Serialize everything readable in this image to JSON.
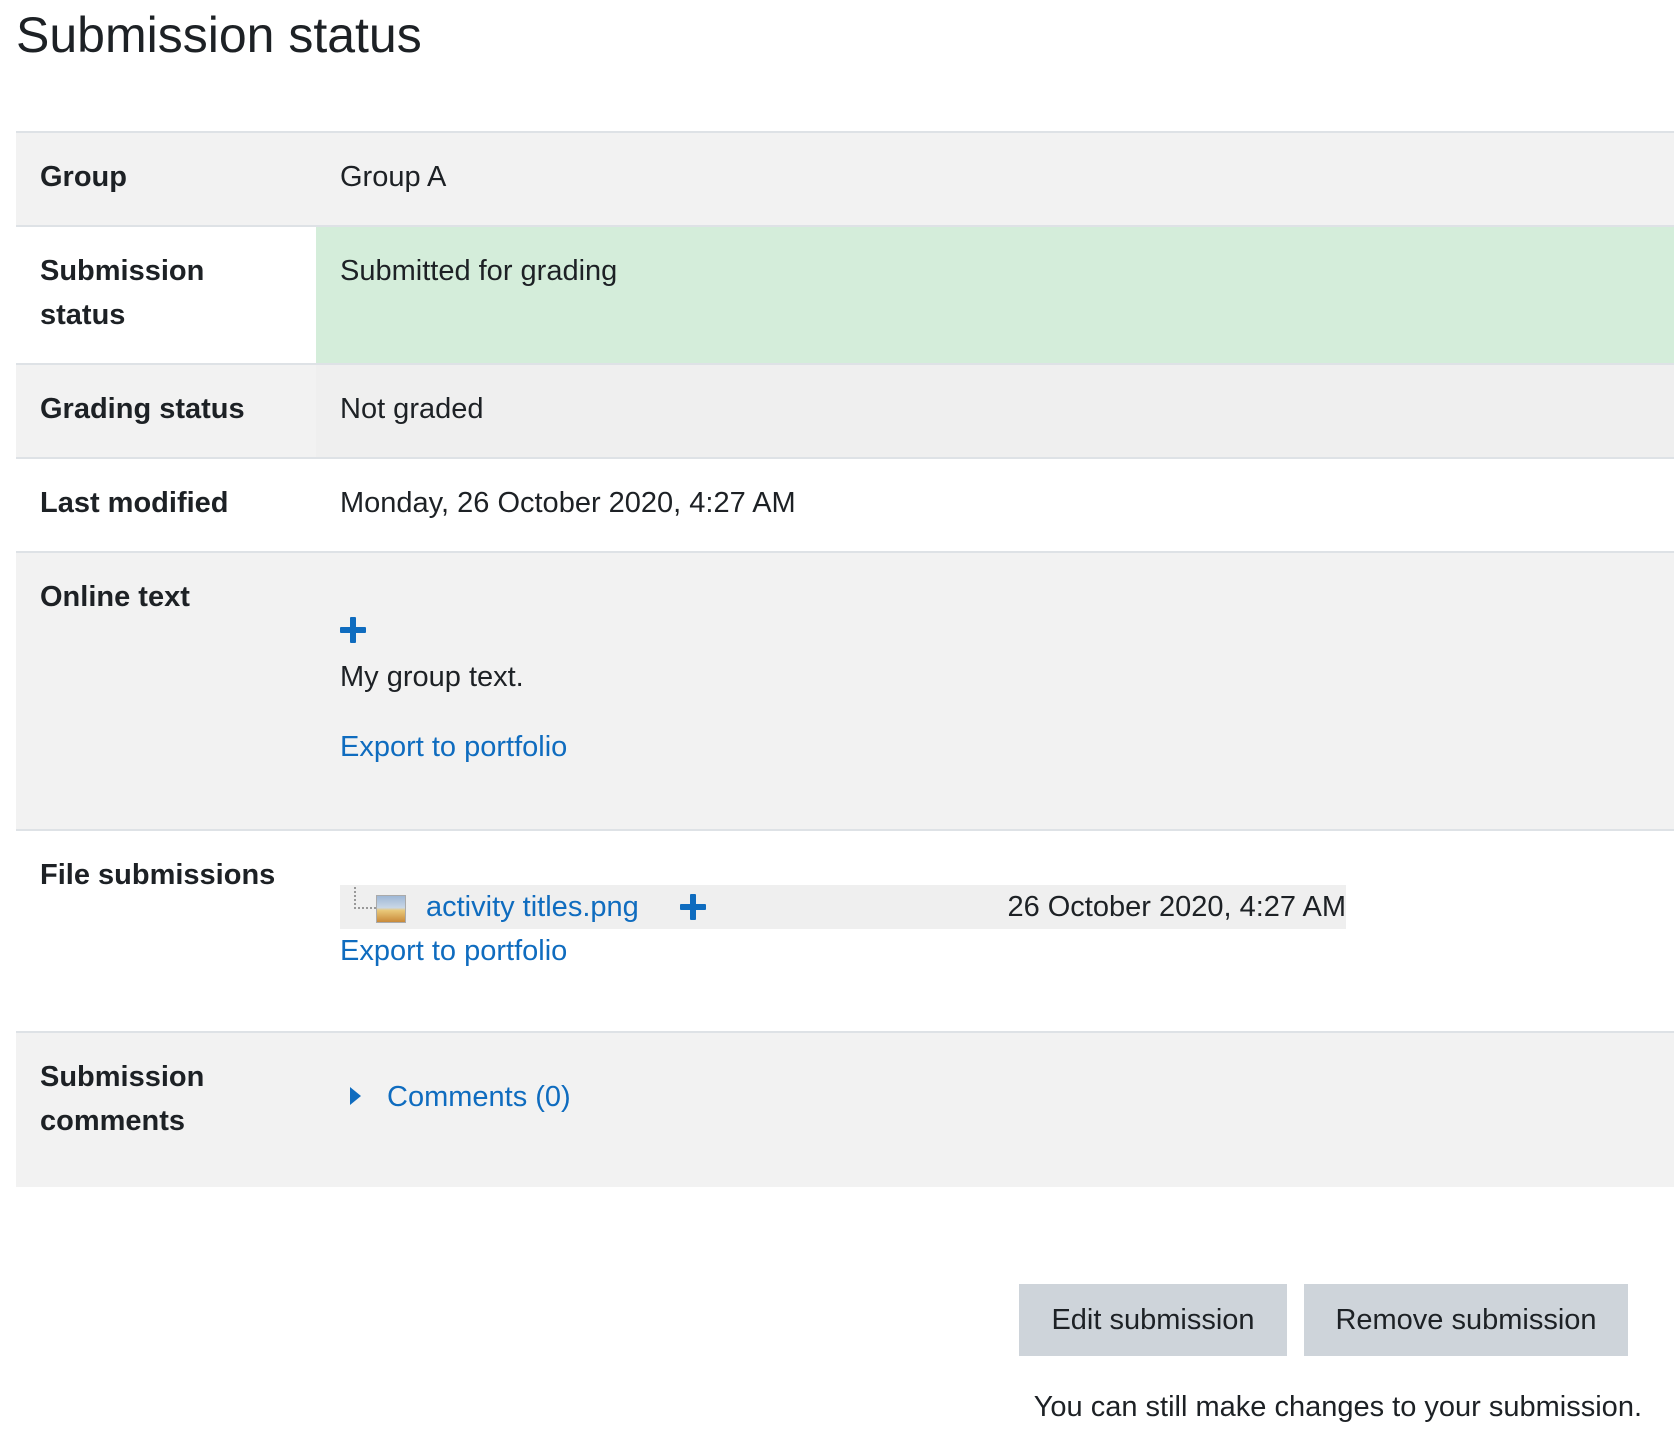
{
  "page": {
    "title": "Submission status"
  },
  "rows": {
    "group": {
      "label": "Group",
      "value": "Group A"
    },
    "submission_status": {
      "label": "Submission status",
      "value": "Submitted for grading"
    },
    "grading_status": {
      "label": "Grading status",
      "value": "Not graded"
    },
    "last_modified": {
      "label": "Last modified",
      "value": "Monday, 26 October 2020, 4:27 AM"
    },
    "online_text": {
      "label": "Online text",
      "expand_icon": "plus-icon",
      "text": "My group text.",
      "export_label": "Export to portfolio"
    },
    "file_submissions": {
      "label": "File submissions",
      "file_icon": "image-icon",
      "file_name": "activity titles.png",
      "file_date": "26 October 2020, 4:27 AM",
      "export_label": "Export to portfolio"
    },
    "submission_comments": {
      "label": "Submission comments",
      "comments_label": "Comments (0)",
      "toggle_icon": "caret-right-icon"
    }
  },
  "actions": {
    "edit_label": "Edit submission",
    "remove_label": "Remove submission",
    "note": "You can still make changes to your submission."
  },
  "colors": {
    "link": "#0f6cbf",
    "status_submitted_bg": "#d4edda",
    "row_alt_bg": "#f2f2f2",
    "button_bg": "#ced4da"
  }
}
